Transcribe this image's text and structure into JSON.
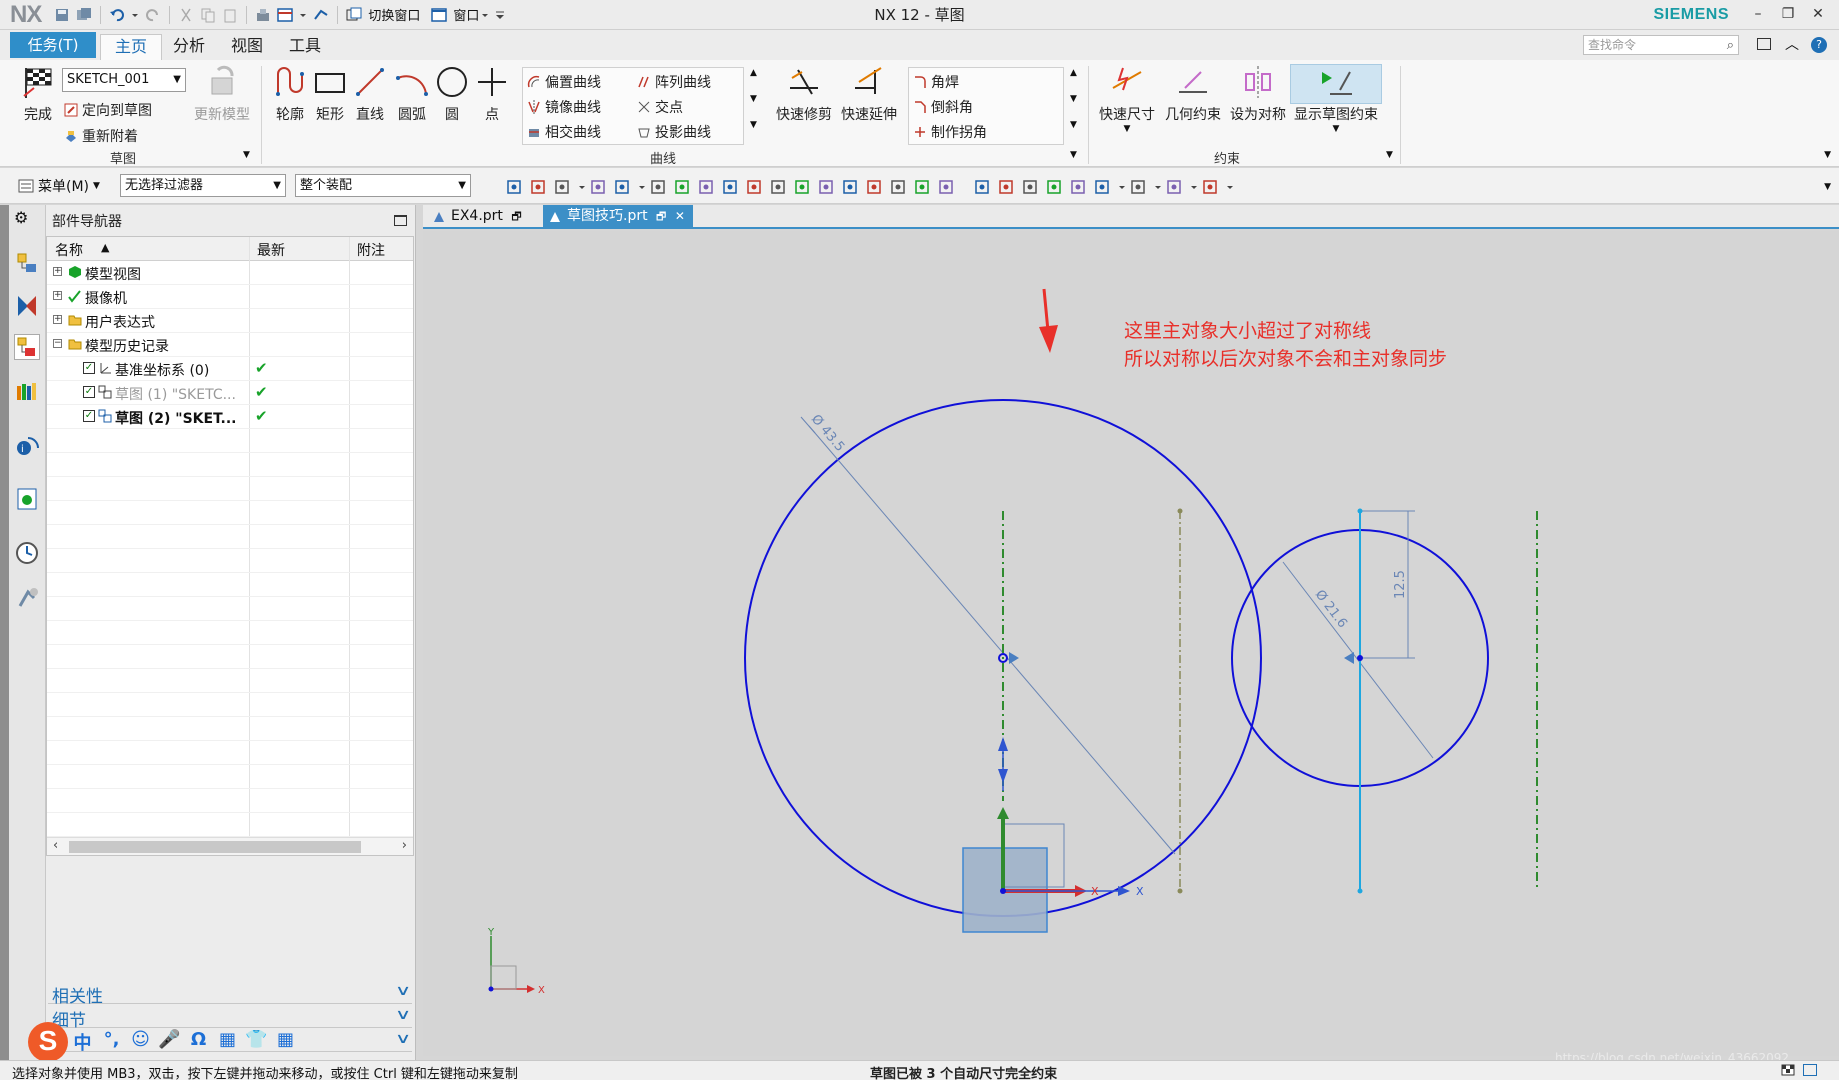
{
  "titlebar": {
    "logo": "NX",
    "title": "NX 12 - 草图",
    "brand": "SIEMENS",
    "switch_window": "切换窗口",
    "window_menu": "窗口",
    "minimize": "–",
    "restore": "❐",
    "close": "✕"
  },
  "tabs": {
    "task": "任务(T)",
    "items": [
      "主页",
      "分析",
      "视图",
      "工具"
    ],
    "active": "主页",
    "search_placeholder": "查找命令"
  },
  "ribbon": {
    "sketch_group": {
      "finish": "完成",
      "sketch_name": "SKETCH_001",
      "orient": "定向到草图",
      "reattach": "重新附着",
      "update_model": "更新模型",
      "label": "草图"
    },
    "curve_tools": {
      "profile": "轮廓",
      "rectangle": "矩形",
      "line": "直线",
      "arc": "圆弧",
      "circle": "圆",
      "point": "点",
      "offset": "偏置曲线",
      "pattern": "阵列曲线",
      "mirror": "镜像曲线",
      "intersect_pt": "交点",
      "intersect_curve": "相交曲线",
      "project": "投影曲线",
      "quick_trim": "快速修剪",
      "quick_extend": "快速延伸",
      "fillet": "角焊",
      "chamfer": "倒斜角",
      "make_corner": "制作拐角",
      "label": "曲线"
    },
    "constraint_group": {
      "rapid_dim": "快速尺寸",
      "geo_con": "几何约束",
      "make_symmetric": "设为对称",
      "show_con": "显示草图约束",
      "label": "约束"
    }
  },
  "toolbar2": {
    "menu": "菜单(M)",
    "filter": "无选择过滤器",
    "scope": "整个装配"
  },
  "navigator": {
    "title": "部件导航器",
    "columns": [
      "名称",
      "最新",
      "附注"
    ],
    "rows": [
      {
        "label": "模型视图",
        "level": 0,
        "expand": "+",
        "check": ""
      },
      {
        "label": "摄像机",
        "level": 0,
        "expand": "+",
        "check": ""
      },
      {
        "label": "用户表达式",
        "level": 0,
        "expand": "+",
        "check": ""
      },
      {
        "label": "模型历史记录",
        "level": 0,
        "expand": "−",
        "check": ""
      },
      {
        "label": "基准坐标系 (0)",
        "level": 1,
        "expand": "",
        "check": "✔"
      },
      {
        "label": "草图 (1) \"SKETC...",
        "level": 1,
        "expand": "",
        "check": "✔"
      },
      {
        "label": "草图 (2) \"SKET...",
        "level": 1,
        "expand": "",
        "check": "✔"
      }
    ],
    "accordion": [
      "相关性",
      "细节",
      ""
    ]
  },
  "documents": {
    "tabs": [
      "EX4.prt",
      "草图技巧.prt"
    ],
    "active": "草图技巧.prt"
  },
  "canvas": {
    "annotation_line1": "这里主对象大小超过了对称线",
    "annotation_line2": "所以对称以后次对象不会和主对象同步",
    "dim_big": "Ø 43.5",
    "dim_small": "Ø 21.6",
    "dim_vert": "12.5",
    "axis_x": "X",
    "axis_y": "Y",
    "watermark": "https://blog.csdn.net/weixin_43662092"
  },
  "status": {
    "left": "选择对象并使用 MB3，双击，按下左键并拖动来移动，或按住 Ctrl 键和左键拖动来复制",
    "center": "草图已被 3 个自动尺寸完全约束"
  },
  "ime": {
    "logo": "S",
    "items": [
      "中",
      "°,",
      "☺",
      "🎤",
      "Ω",
      "▦",
      "👕",
      "▦"
    ]
  },
  "colors": {
    "accent": "#2f8ec9",
    "sketch_curve": "#1010d8",
    "centerline": "#2f8b2f",
    "annotation": "#e8302a"
  }
}
